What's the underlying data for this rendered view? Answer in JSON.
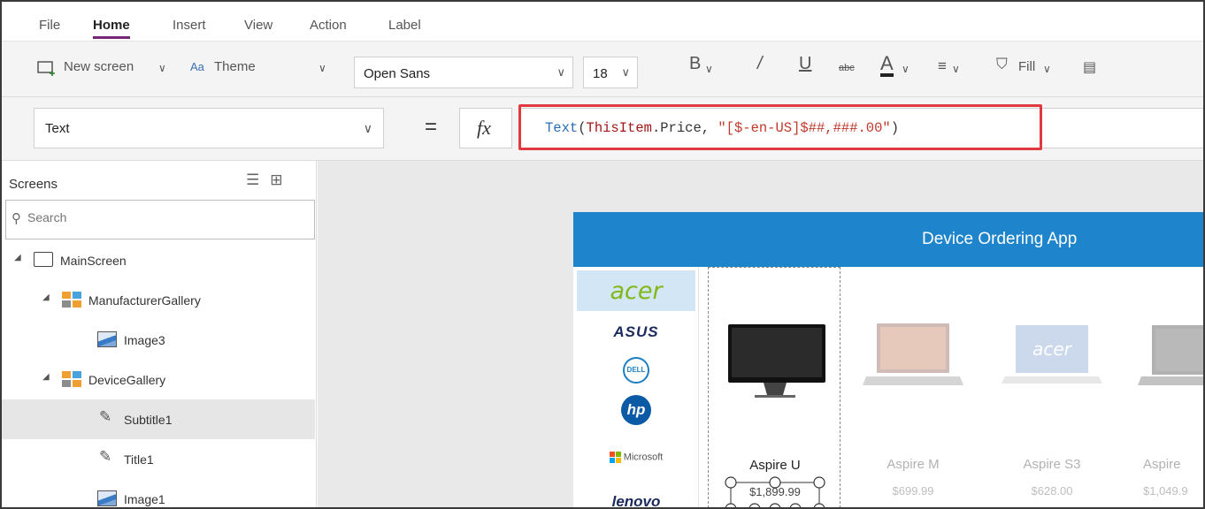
{
  "menu": {
    "tabs": [
      "File",
      "Home",
      "Insert",
      "View",
      "Action",
      "Label"
    ],
    "active": "Home"
  },
  "ribbon": {
    "new_screen": "New screen",
    "theme": "Theme",
    "font_family": "Open Sans",
    "font_size": "18",
    "bold": "B",
    "italic": "/",
    "underline": "U",
    "strikethrough": "abc",
    "font_color": "A",
    "fill": "Fill"
  },
  "formula_bar": {
    "property": "Text",
    "equals": "=",
    "fx": "fx",
    "formula": {
      "fn": "Text",
      "open": "(",
      "obj": "ThisItem",
      "rest": ".Price, ",
      "str": "\"[$-en-US]$##,###.00\"",
      "close": ")"
    },
    "highlight_color": "#e0393e"
  },
  "tree": {
    "header": "Screens",
    "search_placeholder": "Search",
    "nodes": [
      {
        "label": "MainScreen",
        "icon": "screen-icon"
      },
      {
        "label": "ManufacturerGallery",
        "icon": "gallery-icon"
      },
      {
        "label": "Image3",
        "icon": "image-icon"
      },
      {
        "label": "DeviceGallery",
        "icon": "gallery-icon"
      },
      {
        "label": "Subtitle1",
        "icon": "edit-icon"
      },
      {
        "label": "Title1",
        "icon": "edit-icon"
      },
      {
        "label": "Image1",
        "icon": "image-icon"
      }
    ],
    "selected": "Subtitle1"
  },
  "app": {
    "title": "Device Ordering App",
    "header_color": "#1e84cc",
    "brands": [
      "acer",
      "ASUS",
      "DELL",
      "hp",
      "Microsoft",
      "lenovo"
    ],
    "selected_brand": "acer",
    "devices": [
      {
        "title": "Aspire U",
        "price": "$1,899.99"
      },
      {
        "title": "Aspire M",
        "price": "$699.99"
      },
      {
        "title": "Aspire S3",
        "price": "$628.00"
      },
      {
        "title": "Aspire",
        "price": "$1,049.9"
      }
    ]
  }
}
